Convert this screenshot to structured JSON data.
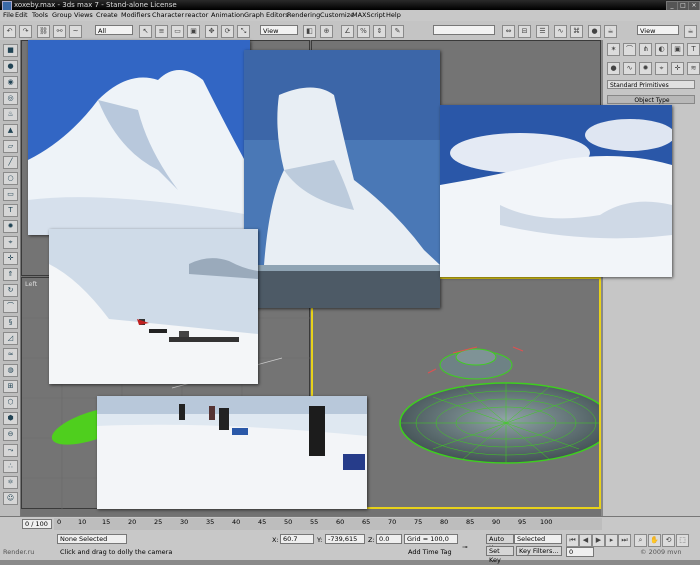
{
  "window": {
    "title": "xoxeby.max - 3ds max 7 - Stand-alone License"
  },
  "menu": [
    "File",
    "Edit",
    "Tools",
    "Group",
    "Views",
    "Create",
    "Modifiers",
    "Character",
    "reactor",
    "Animation",
    "Graph Editors",
    "Rendering",
    "Customize",
    "MAXScript",
    "Help"
  ],
  "toolbar": {
    "selection_filter": "All",
    "ref_coord": "View",
    "right_combo": "View"
  },
  "command_panel": {
    "category": "Standard Primitives",
    "rollout": "Object Type"
  },
  "viewports": {
    "left_label": "Left"
  },
  "timeline": {
    "frame_counter": "0 / 100",
    "ticks": [
      "0",
      "10",
      "15",
      "20",
      "25",
      "30",
      "35",
      "40",
      "45",
      "50",
      "55",
      "60",
      "65",
      "70",
      "75",
      "80",
      "85",
      "90",
      "95",
      "100"
    ]
  },
  "status": {
    "selection": "None Selected",
    "prompt": "Click and drag to dolly the camera",
    "x_label": "X:",
    "x_value": "60.7",
    "y_label": "Y:",
    "y_value": "-739,615",
    "z_label": "Z:",
    "z_value": "0.0",
    "grid": "Grid = 100,0",
    "add_time_tag": "Add Time Tag",
    "auto_key": "Auto Key",
    "selected": "Selected",
    "set_key": "Set Key",
    "key_filters": "Key Filters...",
    "frame": "0",
    "watermark_left": "Render.ru",
    "watermark_right": "© 2009 mvn"
  },
  "colors": {
    "ufo_wire": "#3ecf1e",
    "viewport_bg": "#747474"
  }
}
